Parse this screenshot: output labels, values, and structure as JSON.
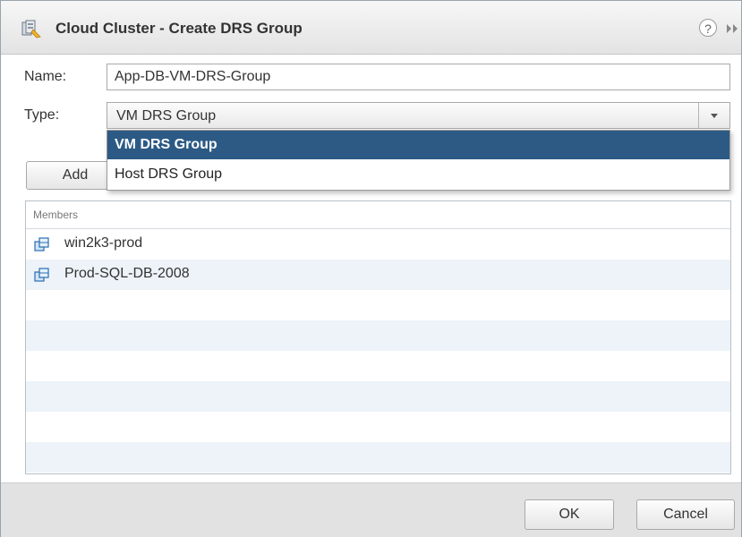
{
  "dialog": {
    "title": "Cloud Cluster - Create DRS Group",
    "title_icon": "cluster-icon",
    "help_label": "?"
  },
  "form": {
    "name_label": "Name:",
    "name_value": "App-DB-VM-DRS-Group",
    "type_label": "Type:",
    "type_value": "VM DRS Group",
    "add_label": "Add"
  },
  "dropdown": {
    "options": [
      {
        "label": "VM DRS Group",
        "selected": true
      },
      {
        "label": "Host DRS Group",
        "selected": false
      }
    ]
  },
  "members": {
    "header": "Members",
    "items": [
      "win2k3-prod",
      "Prod-SQL-DB-2008"
    ],
    "row_icon": "vm-icon"
  },
  "footer": {
    "ok_label": "OK",
    "cancel_label": "Cancel"
  },
  "colors": {
    "selected_bg": "#2c5a85",
    "row_alt": "#edf3f8",
    "footer_bg": "#e2e2e2"
  }
}
